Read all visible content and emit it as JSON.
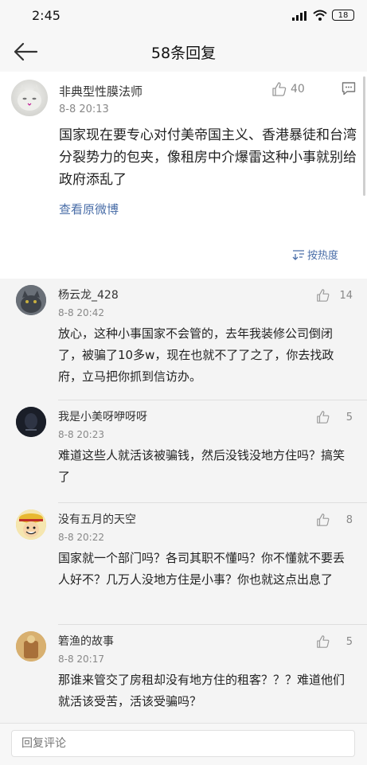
{
  "status_bar": {
    "time": "2:45",
    "battery": "18"
  },
  "nav": {
    "title": "58条回复"
  },
  "main_comment": {
    "username": "非典型性膜法师",
    "date": "8-8 20:13",
    "likes": "40",
    "text": "国家现在要专心对付美帝国主义、香港暴徒和台湾分裂势力的包夹，像租房中介爆雷这种小事就别给政府添乱了",
    "view_original": "查看原微博",
    "sort_label": "按热度"
  },
  "replies": [
    {
      "username": "杨云龙_428",
      "date": "8-8 20:42",
      "likes": "14",
      "text": "放心，这种小事国家不会管的，去年我装修公司倒闭了，被骗了10多w，现在也就不了了之了，你去找政府，立马把你抓到信访办。"
    },
    {
      "username": "我是小美呀咿呀呀",
      "date": "8-8 20:23",
      "likes": "5",
      "text": "难道这些人就活该被骗钱，然后没钱没地方住吗？搞笑了"
    },
    {
      "username": "没有五月的天空",
      "date": "8-8 20:22",
      "likes": "8",
      "text": "国家就一个部门吗？各司其职不懂吗？你不懂就不要丢人好不？几万人没地方住是小事？你也就这点出息了"
    },
    {
      "username": "箬渔的故事",
      "date": "8-8 20:17",
      "likes": "5",
      "text": "那谁来管交了房租却没有地方住的租客？？？难道他们就活该受苦，活该受骗吗？"
    }
  ],
  "bottom_bar": {
    "placeholder": "回复评论"
  },
  "colors": {
    "link": "#4a6ea8",
    "background": "#f4f4f4"
  }
}
